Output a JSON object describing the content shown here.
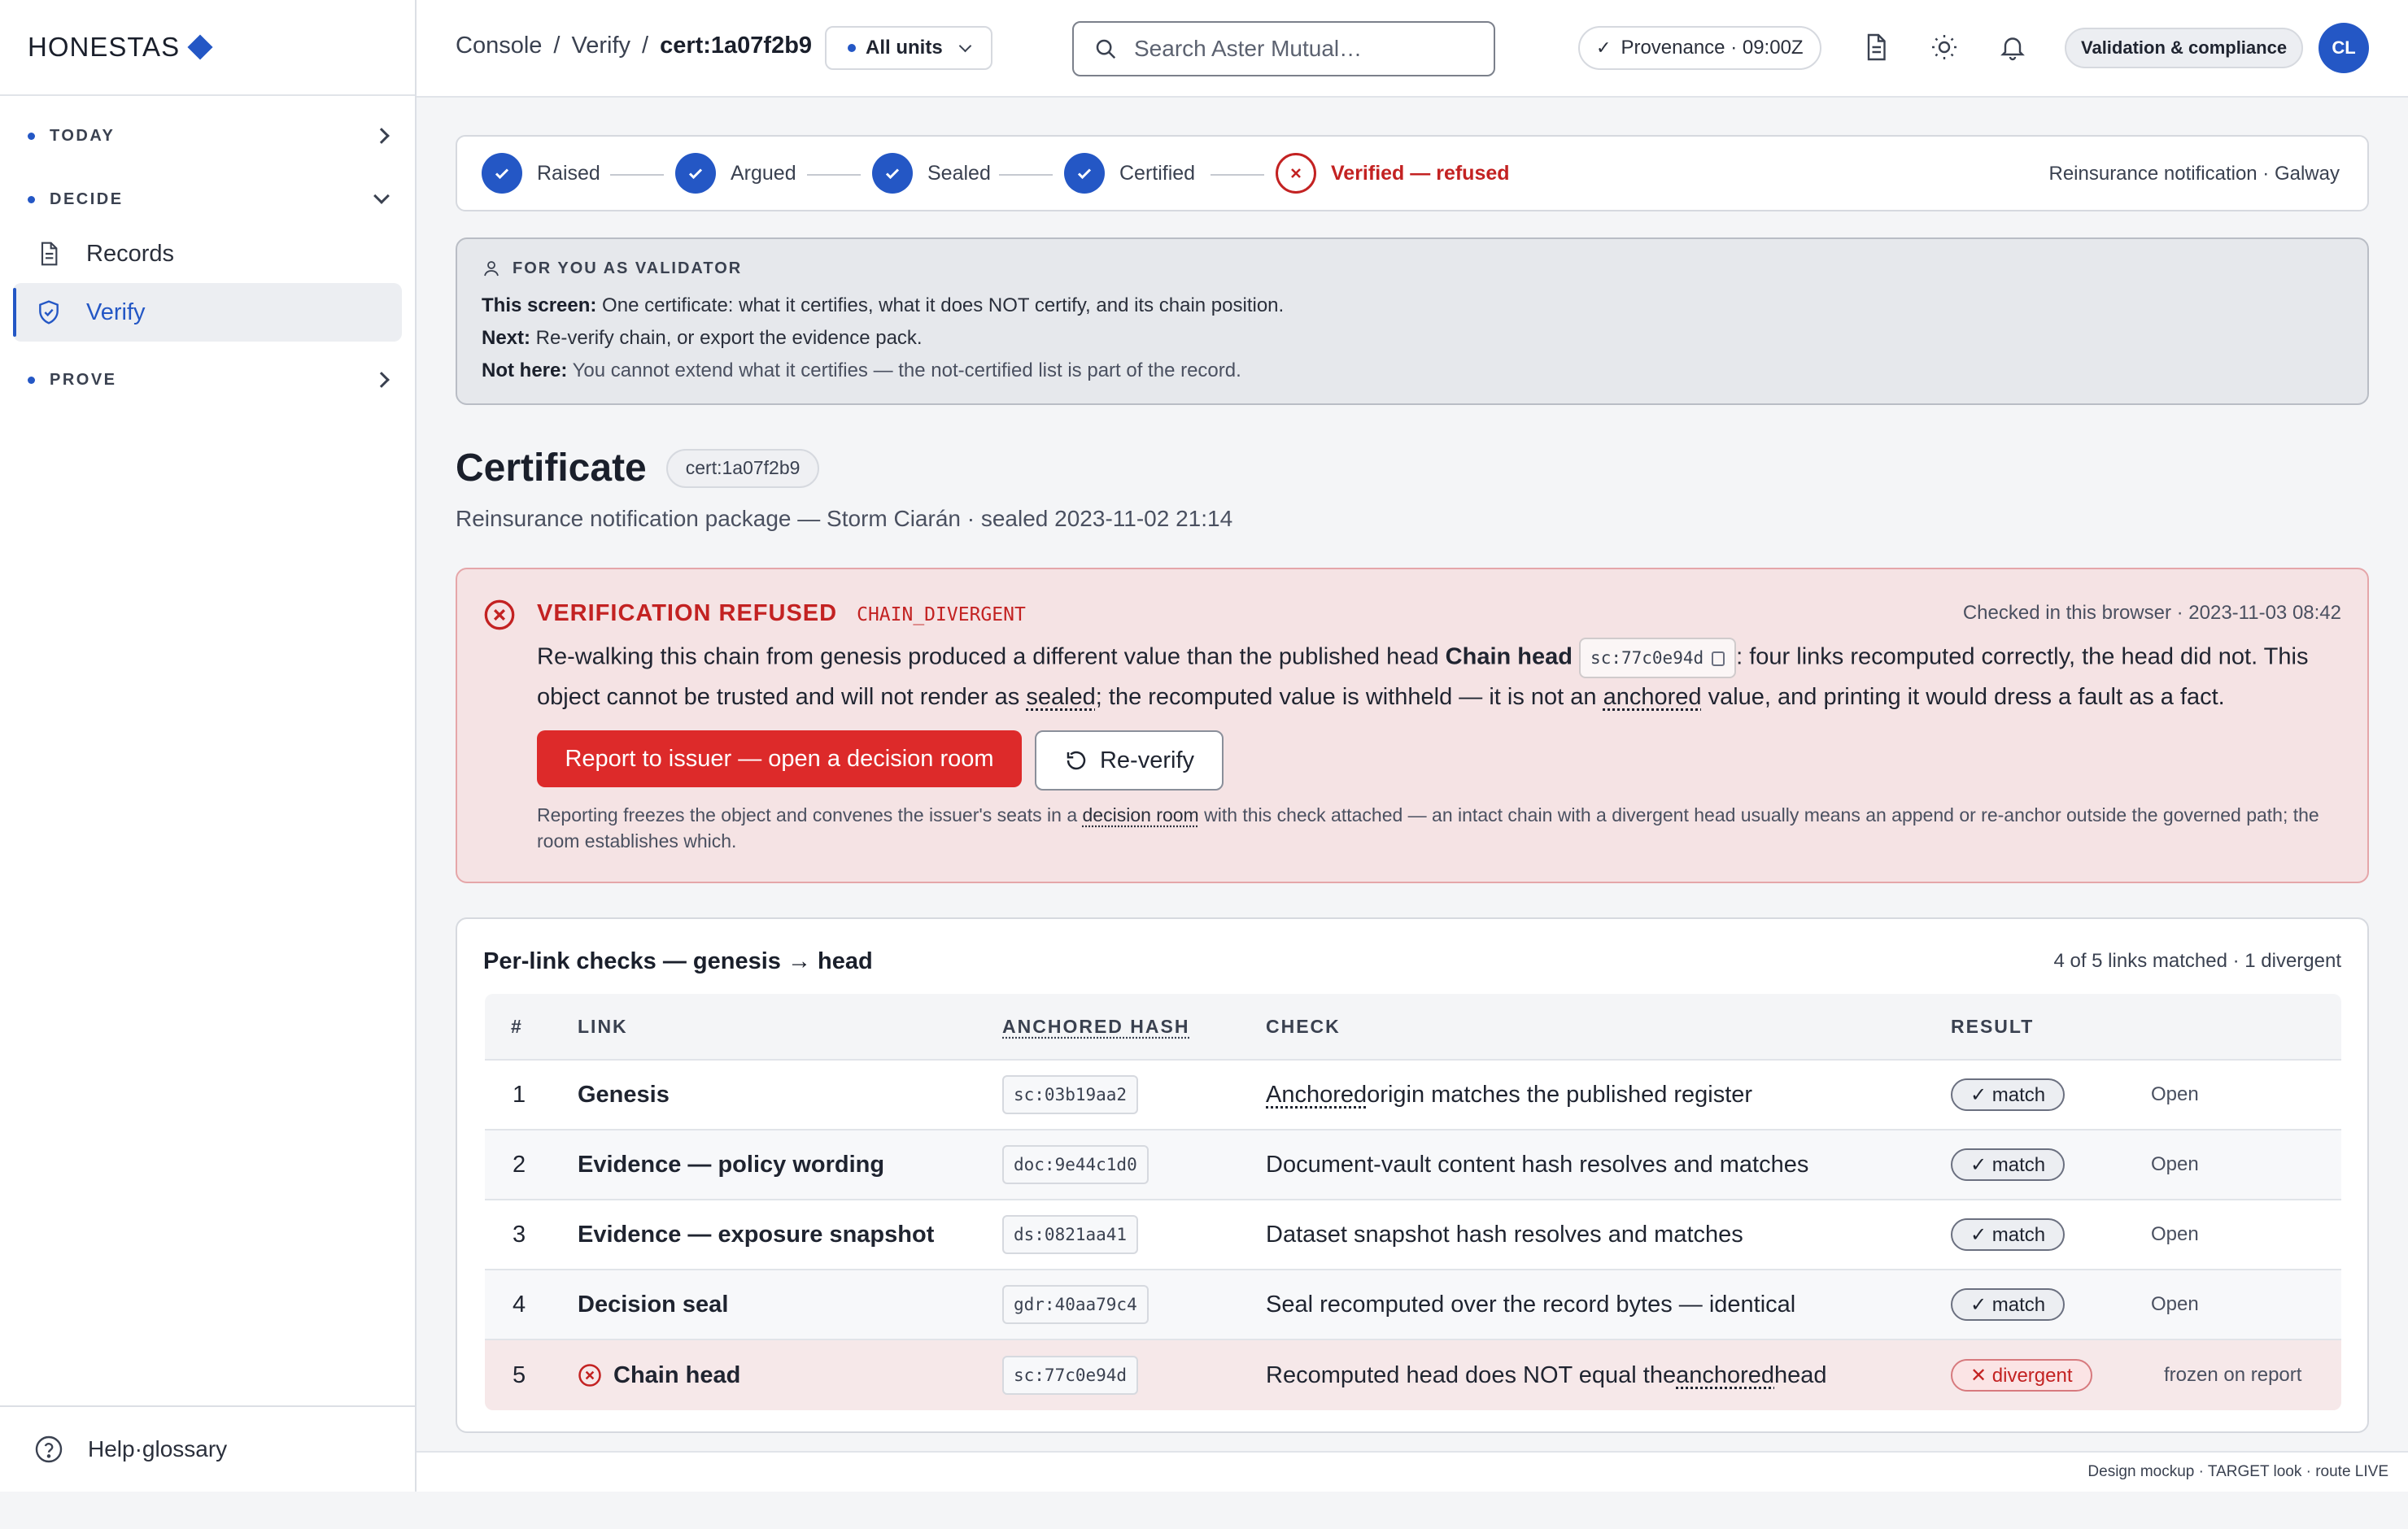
{
  "brand": {
    "name": "HONESTAS"
  },
  "sidebar": {
    "sections": [
      {
        "label": "TODAY"
      },
      {
        "label": "DECIDE"
      },
      {
        "label": "PROVE"
      }
    ],
    "items": [
      {
        "label": "Records"
      },
      {
        "label": "Verify"
      }
    ],
    "help_label": "Help·glossary"
  },
  "topbar": {
    "breadcrumb": [
      "Console",
      "Verify",
      "cert:1a07f2b9"
    ],
    "units_label": "All units",
    "search_placeholder": "Search Aster Mutual…",
    "provenance": "Provenance · 09:00Z",
    "role_badge": "Validation & compliance",
    "avatar_initials": "CL"
  },
  "stepper": {
    "steps": [
      {
        "label": "Raised"
      },
      {
        "label": "Argued"
      },
      {
        "label": "Sealed"
      },
      {
        "label": "Certified"
      },
      {
        "label": "Verified — refused"
      }
    ],
    "note": "Reinsurance notification · Galway"
  },
  "validator": {
    "heading": "FOR YOU AS VALIDATOR",
    "lines": [
      {
        "k": "This screen:",
        "v": " One certificate: what it certifies, what it does NOT certify, and its chain position."
      },
      {
        "k": "Next:",
        "v": " Re-verify chain, or export the evidence pack."
      },
      {
        "k": "Not here:",
        "v": " You cannot extend what it certifies — the not-certified list is part of the record."
      }
    ]
  },
  "certificate": {
    "title": "Certificate",
    "id": "cert:1a07f2b9",
    "subtitle": "Reinsurance notification package — Storm Ciarán · sealed 2023-11-02 21:14"
  },
  "refusal": {
    "title": "VERIFICATION REFUSED",
    "code": "CHAIN_DIVERGENT",
    "checked": "Checked in this browser · 2023-11-03 08:42",
    "body_1": "Re-walking this chain from genesis produced a different value than the published head ",
    "body_head_label": "Chain head",
    "body_hash": "sc:77c0e94d",
    "body_2": ": four links recomputed correctly, the head did not. This object cannot be trusted and will not render as ",
    "body_sealed": "sealed",
    "body_3": "; the recomputed value is withheld — it is not an ",
    "body_anchored": "anchored",
    "body_4": " value, and printing it would dress a fault as a fact.",
    "report_button": "Report to issuer — open a decision room",
    "reverify_button": "Re-verify",
    "foot_1": "Reporting freezes the object and convenes the issuer's seats in a ",
    "foot_link": "decision room",
    "foot_2": " with this check attached — an intact chain with a divergent head usually means an append or re-anchor outside the governed path; the room establishes which."
  },
  "checks": {
    "title": "Per-link checks — genesis → head",
    "summary": "4 of 5 links matched · 1 divergent",
    "columns": [
      "#",
      "LINK",
      "ANCHORED HASH",
      "CHECK",
      "RESULT"
    ],
    "rows": [
      {
        "n": "1",
        "link": "Genesis",
        "hash": "sc:03b19aa2",
        "check_pre": "",
        "check_u": "Anchored",
        "check_post": " origin matches the published register",
        "result": "✓ match",
        "action": "Open"
      },
      {
        "n": "2",
        "link": "Evidence — policy wording",
        "hash": "doc:9e44c1d0",
        "check_pre": "Document-vault content hash resolves and matches",
        "check_u": "",
        "check_post": "",
        "result": "✓ match",
        "action": "Open"
      },
      {
        "n": "3",
        "link": "Evidence — exposure snapshot",
        "hash": "ds:0821aa41",
        "check_pre": "Dataset snapshot hash resolves and matches",
        "check_u": "",
        "check_post": "",
        "result": "✓ match",
        "action": "Open"
      },
      {
        "n": "4",
        "link": "Decision seal",
        "hash": "gdr:40aa79c4",
        "check_pre": "Seal recomputed over the record bytes — identical",
        "check_u": "",
        "check_post": "",
        "result": "✓ match",
        "action": "Open"
      },
      {
        "n": "5",
        "link": "Chain head",
        "hash": "sc:77c0e94d",
        "check_pre": "Recomputed head does NOT equal the ",
        "check_u": "anchored",
        "check_post": " head",
        "result": "✕ divergent",
        "action": "frozen on report"
      }
    ]
  },
  "footer": {
    "text": "Design mockup · TARGET look · route LIVE"
  },
  "colors": {
    "accent": "#2457c5",
    "danger": "#dd2a2a",
    "danger_text": "#c32222"
  }
}
